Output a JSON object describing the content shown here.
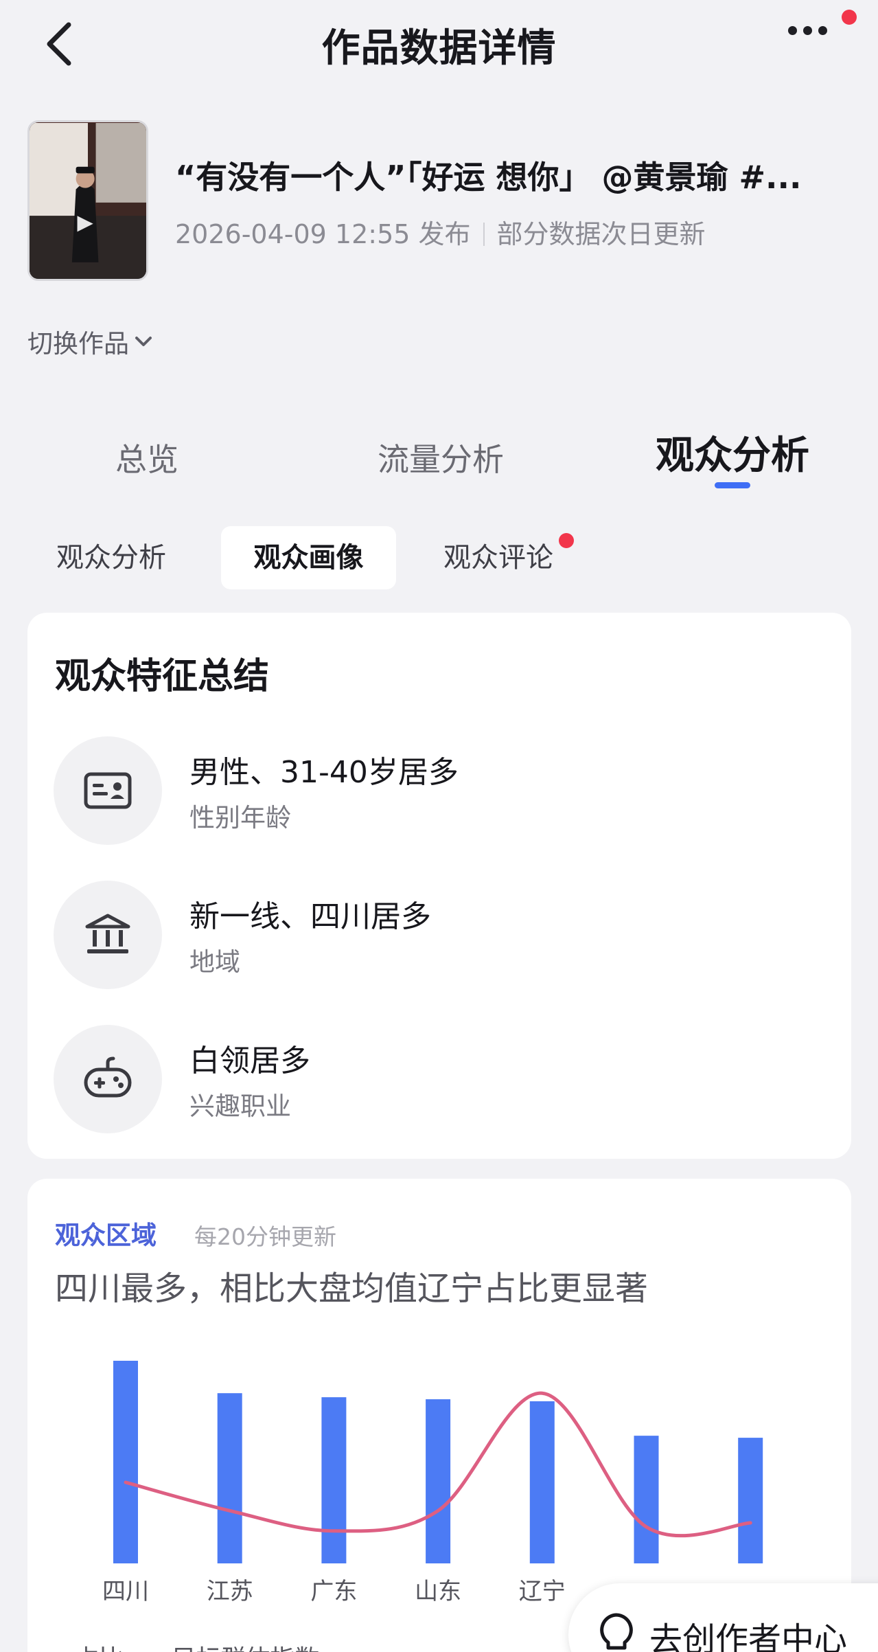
{
  "header": {
    "title": "作品数据详情",
    "back_icon": "chevron-left-icon",
    "more_icon": "more-horizontal-icon",
    "notification_color": "#f2364b"
  },
  "work": {
    "title": "“有没有一个人”「好运 想你」 @黄景瑜 #...",
    "publish_time": "2026-04-09 12:55 发布",
    "update_note": "部分数据次日更新",
    "switch_label": "切换作品"
  },
  "main_tabs": [
    {
      "label": "总览"
    },
    {
      "label": "流量分析"
    },
    {
      "label": "观众分析",
      "active": true
    }
  ],
  "sub_tabs": [
    {
      "label": "观众分析"
    },
    {
      "label": "观众画像",
      "active": true
    },
    {
      "label": "观众评论",
      "badge": true
    }
  ],
  "summary": {
    "title": "观众特征总结",
    "items": [
      {
        "icon": "id-card-icon",
        "value": "男性、31-40岁居多",
        "label": "性别年龄"
      },
      {
        "icon": "bank-building-icon",
        "value": "新一线、四川居多",
        "label": "地域"
      },
      {
        "icon": "gamepad-icon",
        "value": "白领居多",
        "label": "兴趣职业"
      }
    ]
  },
  "region": {
    "title": "观众区域",
    "update_freq": "每20分钟更新",
    "headline": "四川最多，相比大盘均值辽宁占比更显著"
  },
  "chart_data": {
    "type": "bar",
    "categories": [
      "四川",
      "江苏",
      "广东",
      "山东",
      "辽宁",
      "",
      ""
    ],
    "series": [
      {
        "name": "占比",
        "type": "bar",
        "color": "#4c7bf4",
        "values": [
          100,
          84,
          82,
          81,
          80,
          63,
          62
        ]
      },
      {
        "name": "目标群体指数",
        "type": "line",
        "color": "#dd5f82",
        "values": [
          40,
          26,
          16,
          26,
          84,
          18,
          20
        ]
      }
    ],
    "ylim": [
      0,
      100
    ],
    "grid": false,
    "legend_position": "bottom-left"
  },
  "float_button": {
    "label": "去创作者中心",
    "icon": "lightbulb-icon"
  }
}
